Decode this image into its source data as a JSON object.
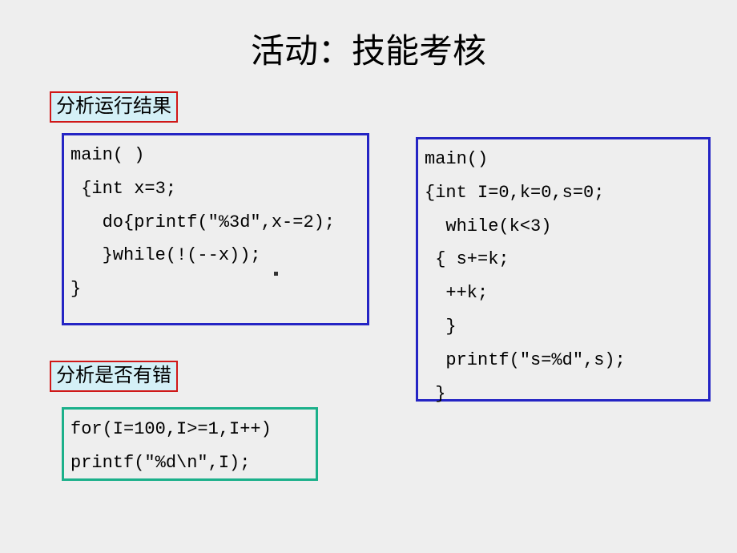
{
  "title": "活动：技能考核",
  "label1": "分析运行结果",
  "label2": "分析是否有错",
  "code1": "main( )\n {int x=3;\n   do{printf(\"%3d\",x-=2);\n   }while(!(--x));\n}",
  "code2": "main()\n{int I=0,k=0,s=0;\n  while(k<3)\n { s+=k;\n  ++k;\n  }\n  printf(\"s=%d\",s);\n }",
  "code3": "for(I=100,I>=1,I++)\nprintf(\"%d\\n\",I);"
}
